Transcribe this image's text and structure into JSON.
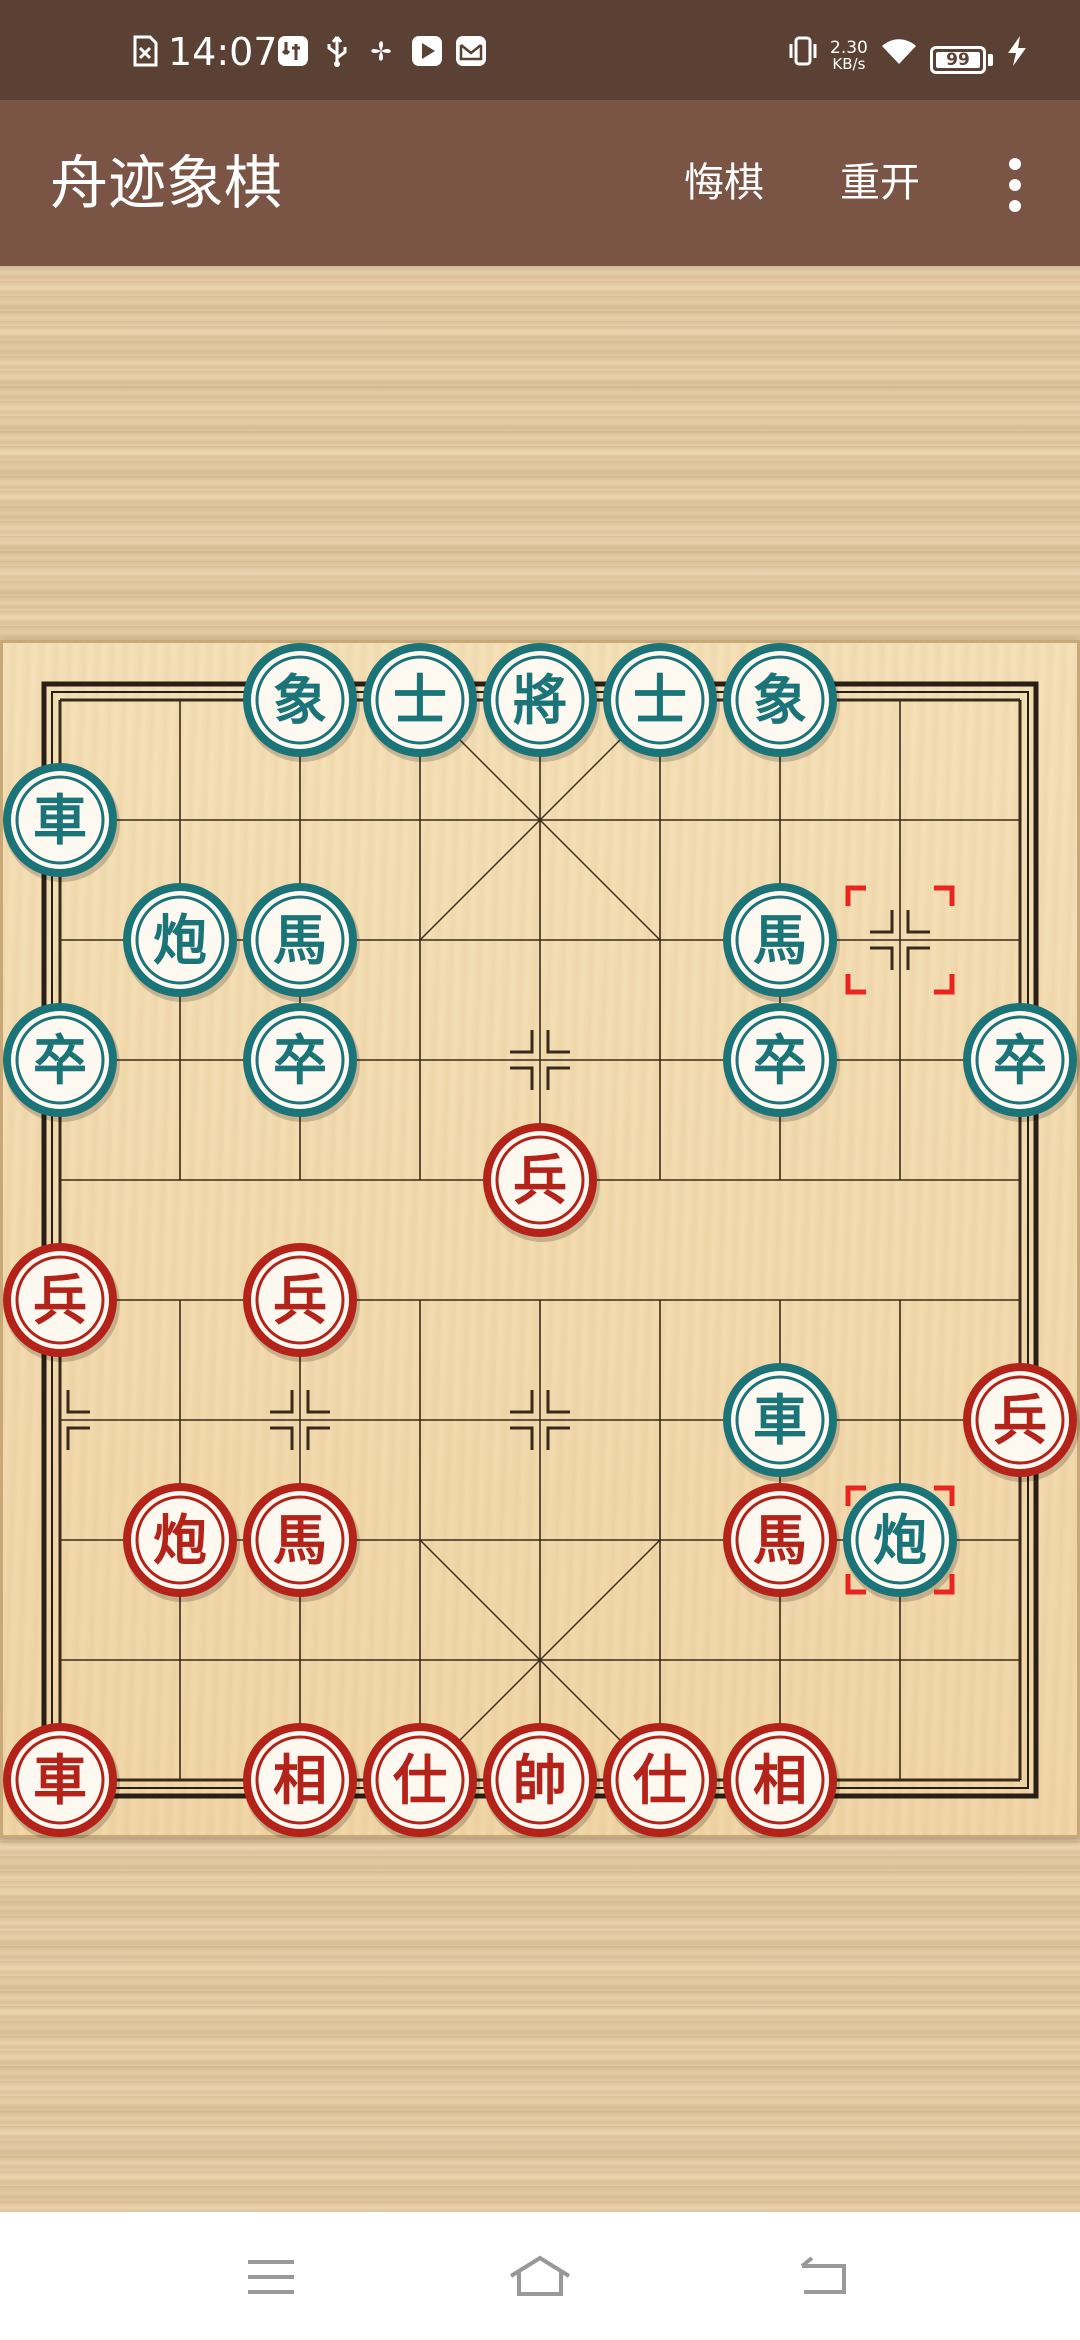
{
  "status_bar": {
    "time": "14:07",
    "network_speed_value": "2.30",
    "network_speed_unit": "KB/s",
    "battery": "99",
    "icons": [
      "sim-off-icon",
      "usb-debug-icon",
      "usb-icon",
      "pinwheel-icon",
      "play-icon",
      "mail-icon",
      "vibrate-icon",
      "wifi-icon",
      "battery-icon",
      "charging-icon"
    ]
  },
  "app_bar": {
    "title": "舟迹象棋",
    "undo_label": "悔棋",
    "restart_label": "重开",
    "menu_icon": "more-vert-icon"
  },
  "colors": {
    "status_bar_bg": "#5b4034",
    "app_bar_bg": "#7a5546",
    "red_piece": "#b3231a",
    "green_piece": "#1a7478",
    "selection": "#e8261f"
  },
  "board": {
    "files": 9,
    "ranks": 10,
    "pieces": [
      {
        "side": "green",
        "char": "象",
        "col": 2,
        "row": 0
      },
      {
        "side": "green",
        "char": "士",
        "col": 3,
        "row": 0
      },
      {
        "side": "green",
        "char": "將",
        "col": 4,
        "row": 0
      },
      {
        "side": "green",
        "char": "士",
        "col": 5,
        "row": 0
      },
      {
        "side": "green",
        "char": "象",
        "col": 6,
        "row": 0
      },
      {
        "side": "green",
        "char": "車",
        "col": 0,
        "row": 1
      },
      {
        "side": "green",
        "char": "炮",
        "col": 1,
        "row": 2
      },
      {
        "side": "green",
        "char": "馬",
        "col": 2,
        "row": 2
      },
      {
        "side": "green",
        "char": "馬",
        "col": 6,
        "row": 2
      },
      {
        "side": "green",
        "char": "卒",
        "col": 0,
        "row": 3
      },
      {
        "side": "green",
        "char": "卒",
        "col": 2,
        "row": 3
      },
      {
        "side": "green",
        "char": "卒",
        "col": 6,
        "row": 3
      },
      {
        "side": "green",
        "char": "卒",
        "col": 8,
        "row": 3
      },
      {
        "side": "red",
        "char": "兵",
        "col": 4,
        "row": 4
      },
      {
        "side": "red",
        "char": "兵",
        "col": 0,
        "row": 5
      },
      {
        "side": "red",
        "char": "兵",
        "col": 2,
        "row": 5
      },
      {
        "side": "green",
        "char": "車",
        "col": 6,
        "row": 6
      },
      {
        "side": "red",
        "char": "兵",
        "col": 8,
        "row": 6
      },
      {
        "side": "red",
        "char": "炮",
        "col": 1,
        "row": 7
      },
      {
        "side": "red",
        "char": "馬",
        "col": 2,
        "row": 7
      },
      {
        "side": "red",
        "char": "馬",
        "col": 6,
        "row": 7
      },
      {
        "side": "green",
        "char": "炮",
        "col": 7,
        "row": 7
      },
      {
        "side": "red",
        "char": "車",
        "col": 0,
        "row": 9
      },
      {
        "side": "red",
        "char": "相",
        "col": 2,
        "row": 9
      },
      {
        "side": "red",
        "char": "仕",
        "col": 3,
        "row": 9
      },
      {
        "side": "red",
        "char": "帥",
        "col": 4,
        "row": 9
      },
      {
        "side": "red",
        "char": "仕",
        "col": 5,
        "row": 9
      },
      {
        "side": "red",
        "char": "相",
        "col": 6,
        "row": 9
      }
    ],
    "last_move": {
      "from": {
        "col": 7,
        "row": 2
      },
      "to": {
        "col": 7,
        "row": 7
      }
    }
  },
  "nav_bar": {
    "menu_icon": "menu-icon",
    "home_icon": "home-icon",
    "back_icon": "back-icon"
  }
}
